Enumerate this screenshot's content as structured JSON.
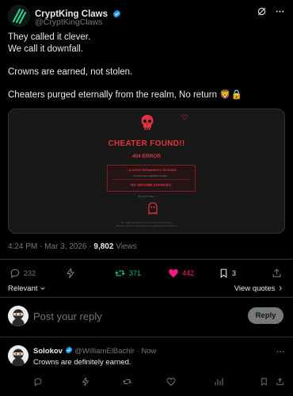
{
  "post": {
    "author_name": "CryptKing Claws",
    "author_handle": "@CryptKingClaws",
    "lines": [
      "They called it clever.",
      "We call it downfall.",
      "Crowns are earned, not stolen.",
      "Cheaters purged eternally from the realm, No return 🦁🔒"
    ],
    "time": "4:24 PM · Mar 3, 2026 · ",
    "views_count": "9,802",
    "views_label": " Views"
  },
  "media": {
    "title": "CHEATER FOUND!!",
    "subtitle": "404 ERROR",
    "warning_title": "⚠ ACCESS PERMANENTLY REVOKED",
    "warning_sub": "You have been identified cheater ...",
    "warning_note": "NO SECOND CHANCES.",
    "mini_handle": "♞ Noxx Drakes",
    "footer_1": "The realm has been cleansed. Justice is irreversible.",
    "footer_2": "Fairness is enforced. Every last one is watched & remembered."
  },
  "actions": {
    "replies": "232",
    "retweets": "371",
    "likes": "442",
    "bookmarks": "3"
  },
  "sort": {
    "relevant": "Relevant",
    "view_quotes": "View quotes"
  },
  "composer": {
    "placeholder": "Post your reply",
    "button": "Reply"
  },
  "comment": {
    "name": "Solokov",
    "handle": "@WilliamElBachir",
    "time": "Now",
    "text": "Crowns are definitely earned."
  },
  "colors": {
    "accent_blue": "#1d9bf0",
    "retweet_green": "#00ba7c",
    "like_pink": "#f91880",
    "error_red": "#e0333c"
  }
}
